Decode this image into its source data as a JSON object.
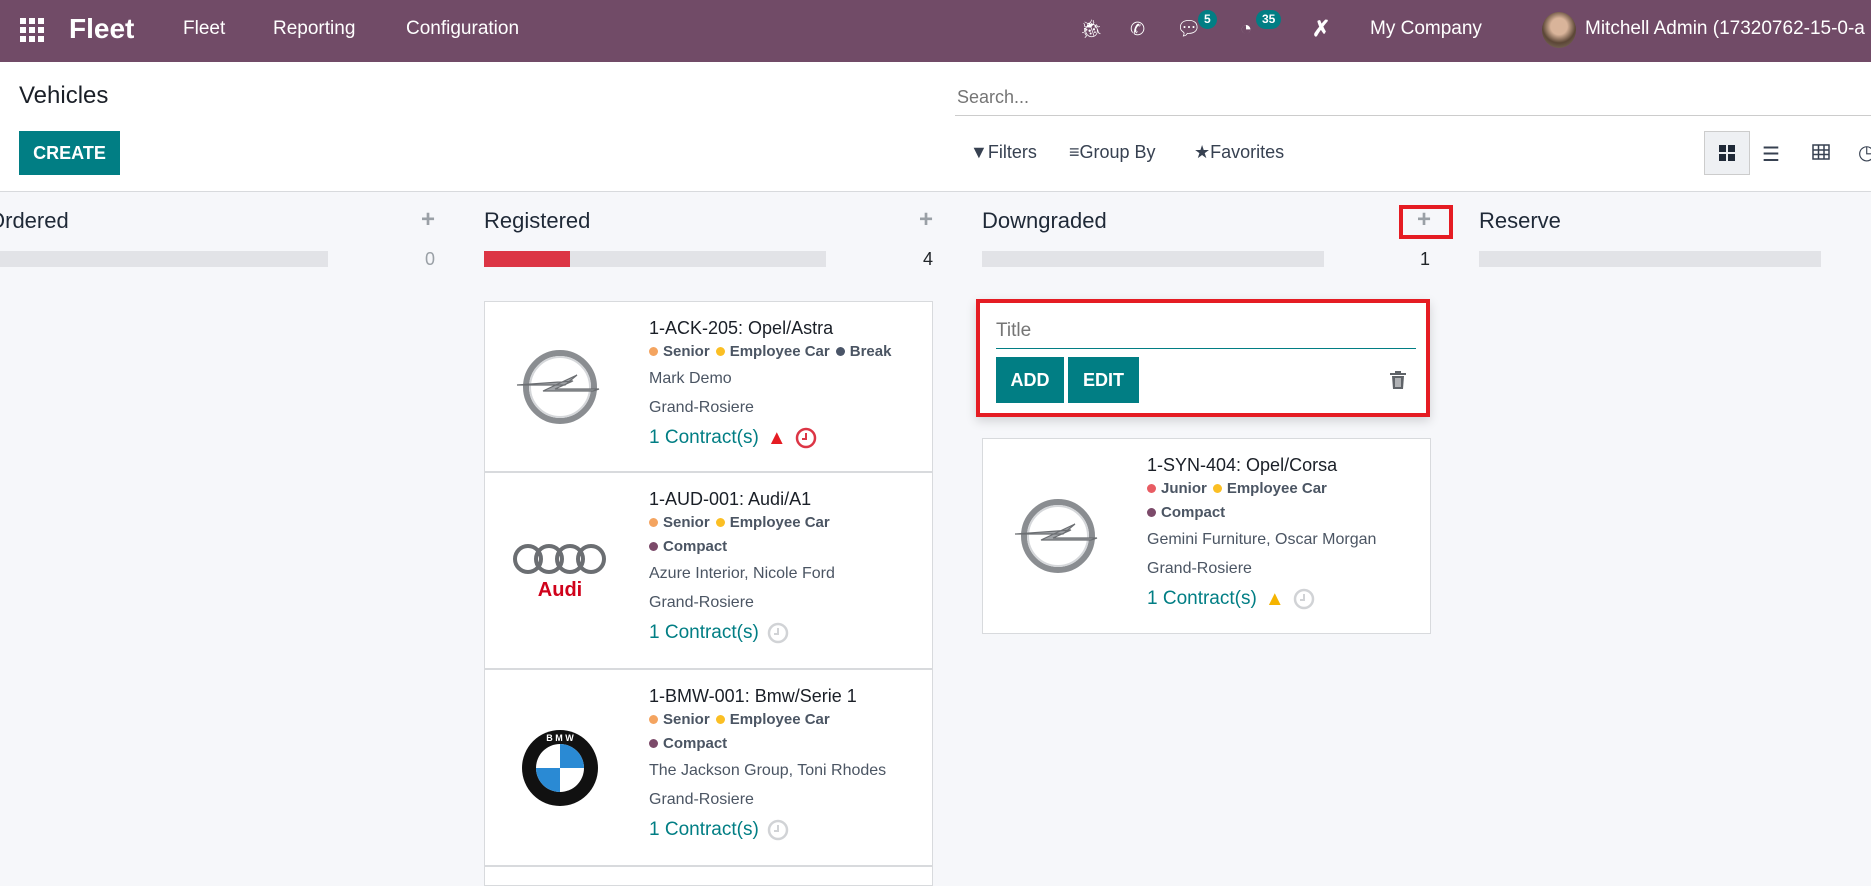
{
  "navbar": {
    "brand": "Fleet",
    "menu": [
      "Fleet",
      "Reporting",
      "Configuration"
    ],
    "messages_count": "5",
    "activities_count": "35",
    "company": "My Company",
    "user": "Mitchell Admin (17320762-15-0-a",
    "bg_color": "#714b67"
  },
  "control_panel": {
    "title": "Vehicles",
    "create_label": "CREATE",
    "search_placeholder": "Search...",
    "filters_label": "Filters",
    "group_by_label": "Group By",
    "favorites_label": "Favorites",
    "active_view": "kanban"
  },
  "accent_color": "#017e84",
  "columns": [
    {
      "title": "Ordered",
      "count": "0",
      "red_fraction": 0
    },
    {
      "title": "Registered",
      "count": "4",
      "red_fraction": 0.25
    },
    {
      "title": "Downgraded",
      "count": "1",
      "red_fraction": 0
    },
    {
      "title": "Reserve",
      "count": "",
      "red_fraction": 0
    }
  ],
  "quick_create": {
    "placeholder": "Title",
    "add_label": "ADD",
    "edit_label": "EDIT"
  },
  "registered_cards": [
    {
      "title": "1-ACK-205: Opel/Astra",
      "logo": "opel",
      "tags": [
        {
          "name": "Senior",
          "color": "#f4a460"
        },
        {
          "name": "Employee Car",
          "color": "#fbbf24"
        },
        {
          "name": "Break",
          "color": "#4a5568"
        }
      ],
      "driver": "Mark Demo",
      "location": "Grand-Rosiere",
      "contracts": "1 Contract(s)",
      "warning": "red",
      "activity": "overdue"
    },
    {
      "title": "1-AUD-001: Audi/A1",
      "logo": "audi",
      "tags": [
        {
          "name": "Senior",
          "color": "#f4a460"
        },
        {
          "name": "Employee Car",
          "color": "#fbbf24"
        }
      ],
      "tags2": [
        {
          "name": "Compact",
          "color": "#7c4a6a"
        }
      ],
      "driver": "Azure Interior, Nicole Ford",
      "location": "Grand-Rosiere",
      "contracts": "1 Contract(s)",
      "warning": "none",
      "activity": "none"
    },
    {
      "title": "1-BMW-001: Bmw/Serie 1",
      "logo": "bmw",
      "tags": [
        {
          "name": "Senior",
          "color": "#f4a460"
        },
        {
          "name": "Employee Car",
          "color": "#fbbf24"
        }
      ],
      "tags2": [
        {
          "name": "Compact",
          "color": "#7c4a6a"
        }
      ],
      "driver": "The Jackson Group, Toni Rhodes",
      "location": "Grand-Rosiere",
      "contracts": "1 Contract(s)",
      "warning": "none",
      "activity": "none"
    }
  ],
  "downgraded_cards": [
    {
      "title": "1-SYN-404: Opel/Corsa",
      "logo": "opel",
      "tags": [
        {
          "name": "Junior",
          "color": "#e85c63"
        },
        {
          "name": "Employee Car",
          "color": "#fbbf24"
        }
      ],
      "tags2": [
        {
          "name": "Compact",
          "color": "#7c4a6a"
        }
      ],
      "driver": "Gemini Furniture, Oscar Morgan",
      "location": "Grand-Rosiere",
      "contracts": "1 Contract(s)",
      "warning": "yellow",
      "activity": "none"
    }
  ]
}
